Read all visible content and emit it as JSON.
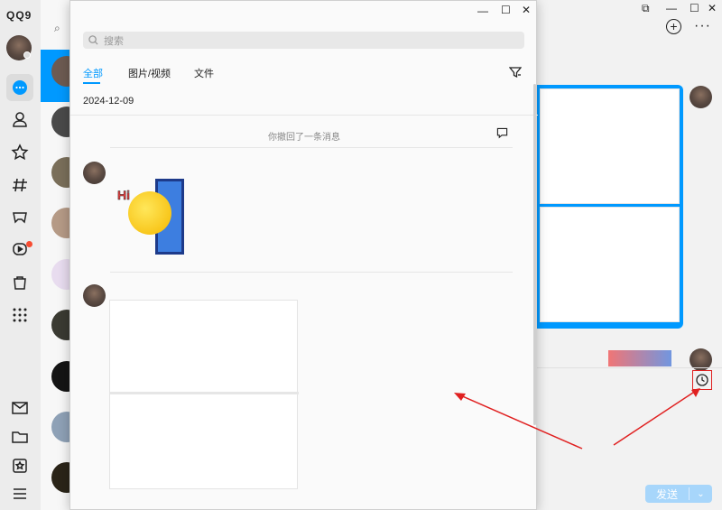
{
  "app": {
    "logo_text": "QQ9"
  },
  "sidebar": {
    "items": [
      {
        "icon": "chat-bubble-icon",
        "active": true
      },
      {
        "icon": "contacts-icon"
      },
      {
        "icon": "star-icon"
      },
      {
        "icon": "hashtag-icon"
      },
      {
        "icon": "game-icon"
      },
      {
        "icon": "video-icon",
        "badge": true
      },
      {
        "icon": "shopping-bag-icon"
      },
      {
        "icon": "apps-grid-icon"
      }
    ],
    "bottom_items": [
      {
        "icon": "mail-icon"
      },
      {
        "icon": "folder-icon"
      },
      {
        "icon": "bookmark-icon"
      },
      {
        "icon": "menu-icon"
      }
    ]
  },
  "history_window": {
    "search_placeholder": "搜索",
    "tabs": [
      "全部",
      "图片/视频",
      "文件"
    ],
    "active_tab": 0,
    "date": "2024-12-09",
    "recall_notice": "你撤回了一条消息",
    "sticker_text": "Hi"
  },
  "chat": {
    "send_label": "发送",
    "send_dropdown": "⌄"
  },
  "colors": {
    "accent": "#0099ff",
    "annotation": "#e02020"
  }
}
